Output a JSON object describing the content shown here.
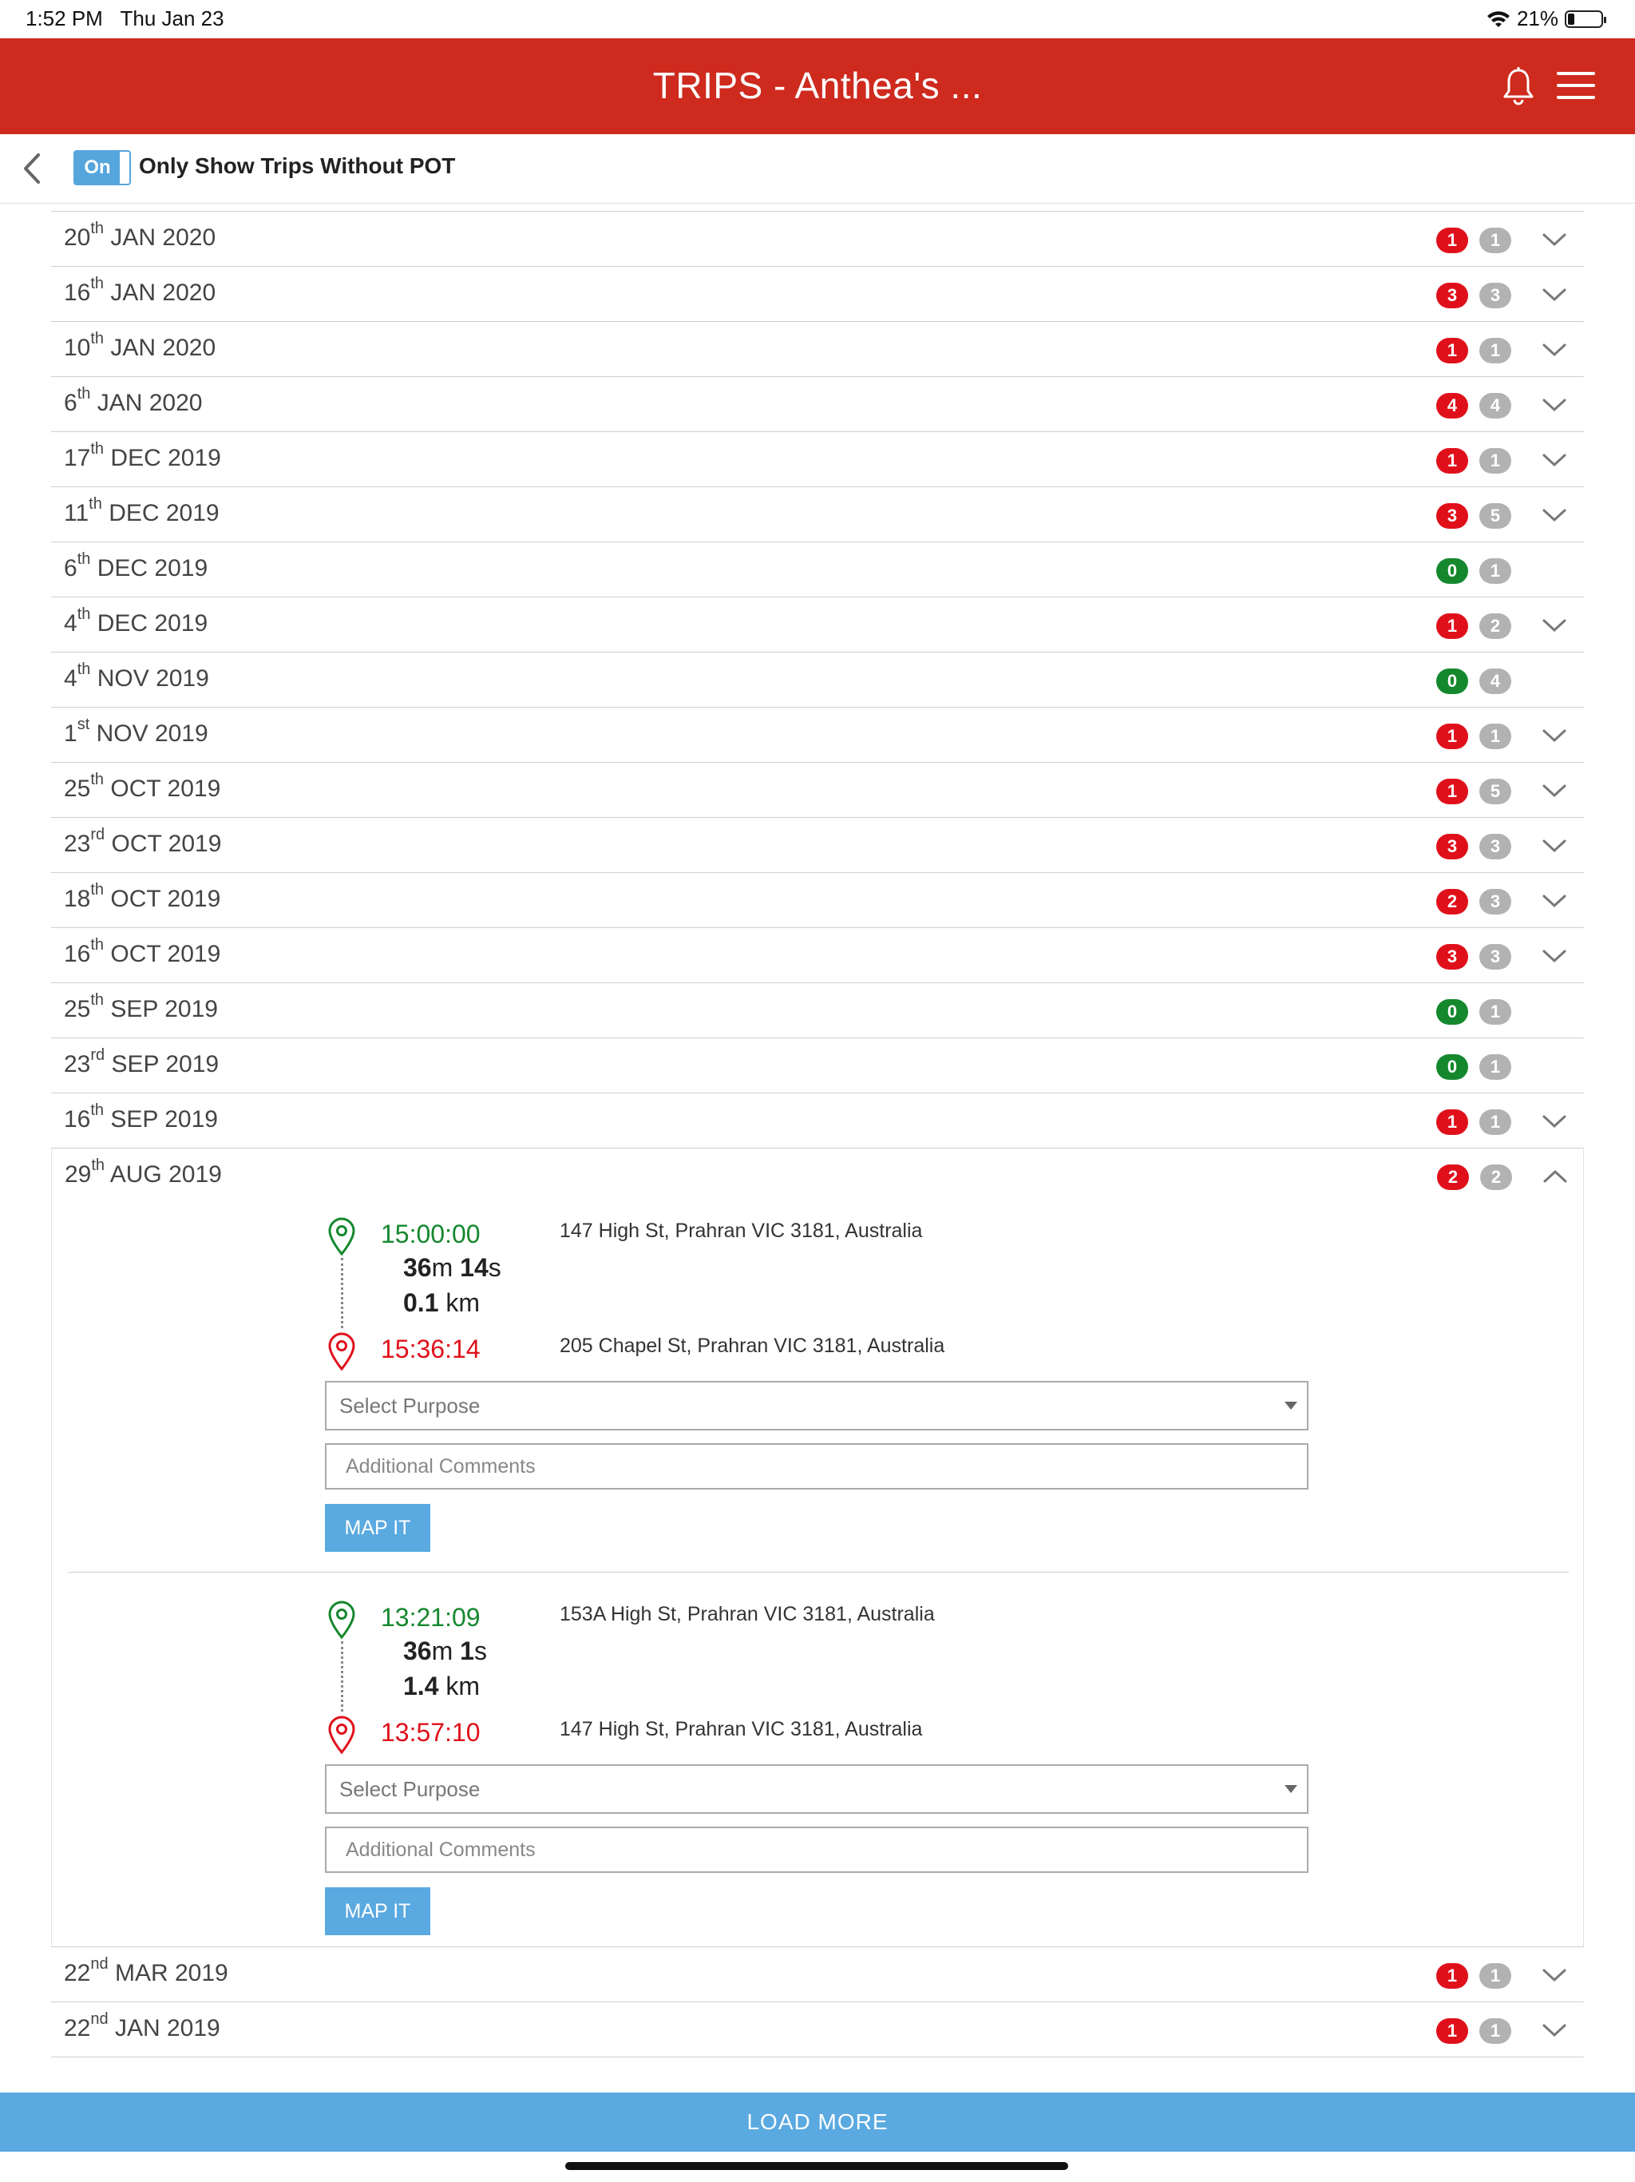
{
  "status_bar": {
    "time": "1:52 PM",
    "date": "Thu Jan 23",
    "battery": "21%",
    "battery_level": 0.21
  },
  "header": {
    "title": "TRIPS - Anthea's ...",
    "icons": [
      "bell-icon",
      "hamburger-menu-icon"
    ]
  },
  "filter": {
    "toggle_label": "On",
    "label": "Only Show Trips Without POT",
    "enabled": true
  },
  "colors": {
    "header": "#ce2a1e",
    "unclassified_badge": "#e0101b",
    "classified_badge": "#15882e",
    "total_badge": "#b2b2b2",
    "accent": "#5aa9e0"
  },
  "days": [
    {
      "day": "20",
      "suffix": "th",
      "rest": "JAN 2020",
      "pending": "1",
      "pending_color": "red",
      "total": "1",
      "expandable": true
    },
    {
      "day": "16",
      "suffix": "th",
      "rest": "JAN 2020",
      "pending": "3",
      "pending_color": "red",
      "total": "3",
      "expandable": true
    },
    {
      "day": "10",
      "suffix": "th",
      "rest": "JAN 2020",
      "pending": "1",
      "pending_color": "red",
      "total": "1",
      "expandable": true
    },
    {
      "day": "6",
      "suffix": "th",
      "rest": "JAN 2020",
      "pending": "4",
      "pending_color": "red",
      "total": "4",
      "expandable": true
    },
    {
      "day": "17",
      "suffix": "th",
      "rest": "DEC 2019",
      "pending": "1",
      "pending_color": "red",
      "total": "1",
      "expandable": true
    },
    {
      "day": "11",
      "suffix": "th",
      "rest": "DEC 2019",
      "pending": "3",
      "pending_color": "red",
      "total": "5",
      "expandable": true
    },
    {
      "day": "6",
      "suffix": "th",
      "rest": "DEC 2019",
      "pending": "0",
      "pending_color": "green",
      "total": "1",
      "expandable": false
    },
    {
      "day": "4",
      "suffix": "th",
      "rest": "DEC 2019",
      "pending": "1",
      "pending_color": "red",
      "total": "2",
      "expandable": true
    },
    {
      "day": "4",
      "suffix": "th",
      "rest": "NOV 2019",
      "pending": "0",
      "pending_color": "green",
      "total": "4",
      "expandable": false
    },
    {
      "day": "1",
      "suffix": "st",
      "rest": "NOV 2019",
      "pending": "1",
      "pending_color": "red",
      "total": "1",
      "expandable": true
    },
    {
      "day": "25",
      "suffix": "th",
      "rest": "OCT 2019",
      "pending": "1",
      "pending_color": "red",
      "total": "5",
      "expandable": true
    },
    {
      "day": "23",
      "suffix": "rd",
      "rest": "OCT 2019",
      "pending": "3",
      "pending_color": "red",
      "total": "3",
      "expandable": true
    },
    {
      "day": "18",
      "suffix": "th",
      "rest": "OCT 2019",
      "pending": "2",
      "pending_color": "red",
      "total": "3",
      "expandable": true
    },
    {
      "day": "16",
      "suffix": "th",
      "rest": "OCT 2019",
      "pending": "3",
      "pending_color": "red",
      "total": "3",
      "expandable": true
    },
    {
      "day": "25",
      "suffix": "th",
      "rest": "SEP 2019",
      "pending": "0",
      "pending_color": "green",
      "total": "1",
      "expandable": false
    },
    {
      "day": "23",
      "suffix": "rd",
      "rest": "SEP 2019",
      "pending": "0",
      "pending_color": "green",
      "total": "1",
      "expandable": false
    },
    {
      "day": "16",
      "suffix": "th",
      "rest": "SEP 2019",
      "pending": "1",
      "pending_color": "red",
      "total": "1",
      "expandable": true
    }
  ],
  "expanded_day": {
    "day": "29",
    "suffix": "th",
    "rest": "AUG 2019",
    "pending": "2",
    "total": "2",
    "trips": [
      {
        "start_time": "15:00:00",
        "start_address": "147 High St, Prahran VIC 3181, Australia",
        "dur_min": "36",
        "dur_min_unit": "m",
        "dur_sec": "14",
        "dur_sec_unit": "s",
        "distance": "0.1",
        "distance_unit": " km",
        "end_time": "15:36:14",
        "end_address": "205 Chapel St, Prahran VIC 3181, Australia",
        "purpose_placeholder": "Select Purpose",
        "comments_placeholder": "Additional Comments",
        "map_button": "MAP IT"
      },
      {
        "start_time": "13:21:09",
        "start_address": "153A High St, Prahran VIC 3181, Australia",
        "dur_min": "36",
        "dur_min_unit": "m",
        "dur_sec": "1",
        "dur_sec_unit": "s",
        "distance": "1.4",
        "distance_unit": " km",
        "end_time": "13:57:10",
        "end_address": "147 High St, Prahran VIC 3181, Australia",
        "purpose_placeholder": "Select Purpose",
        "comments_placeholder": "Additional Comments",
        "map_button": "MAP IT"
      }
    ]
  },
  "days_after": [
    {
      "day": "22",
      "suffix": "nd",
      "rest": "MAR 2019",
      "pending": "1",
      "pending_color": "red",
      "total": "1",
      "expandable": true
    },
    {
      "day": "22",
      "suffix": "nd",
      "rest": "JAN 2019",
      "pending": "1",
      "pending_color": "red",
      "total": "1",
      "expandable": true
    }
  ],
  "load_more": "LOAD MORE"
}
